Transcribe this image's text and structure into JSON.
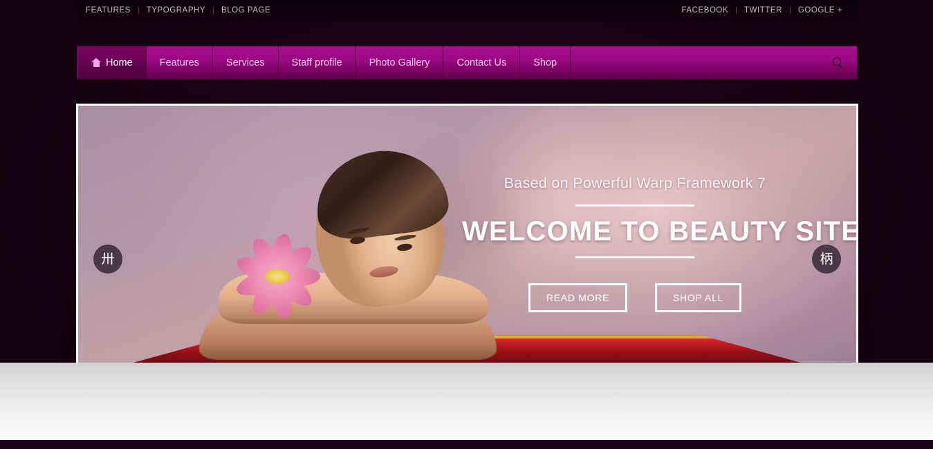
{
  "topbar": {
    "left_links": [
      {
        "label": "FEATURES"
      },
      {
        "label": "TYPOGRAPHY"
      },
      {
        "label": "BLOG PAGE"
      }
    ],
    "separator": "|",
    "right_links": [
      {
        "label": "FACEBOOK"
      },
      {
        "label": "TWITTER"
      },
      {
        "label": "GOOGLE +"
      }
    ]
  },
  "nav": {
    "items": [
      {
        "label": "Home",
        "icon": "home-icon",
        "active": true
      },
      {
        "label": "Features",
        "active": false
      },
      {
        "label": "Services",
        "active": false
      },
      {
        "label": "Staff profile",
        "active": false
      },
      {
        "label": "Photo Gallery",
        "active": false
      },
      {
        "label": "Contact Us",
        "active": false
      },
      {
        "label": "Shop",
        "active": false
      }
    ],
    "search_icon": "search-icon",
    "accent_color": "#a80c8f",
    "accent_dark": "#650050"
  },
  "hero": {
    "subtitle": "Based on Powerful Warp Framework 7",
    "title": "WELCOME TO BEAUTY SITE",
    "buttons": [
      {
        "label": "READ MORE"
      },
      {
        "label": "SHOP ALL"
      }
    ],
    "prev_glyph": "卅",
    "next_glyph": "柄",
    "prev_name": "slider-prev-arrow",
    "next_name": "slider-next-arrow"
  },
  "colors": {
    "page_background": "#1b0213",
    "topbar_background": "#0d0109",
    "hero_border": "#ffffff",
    "text_light": "#c9b9c4"
  }
}
